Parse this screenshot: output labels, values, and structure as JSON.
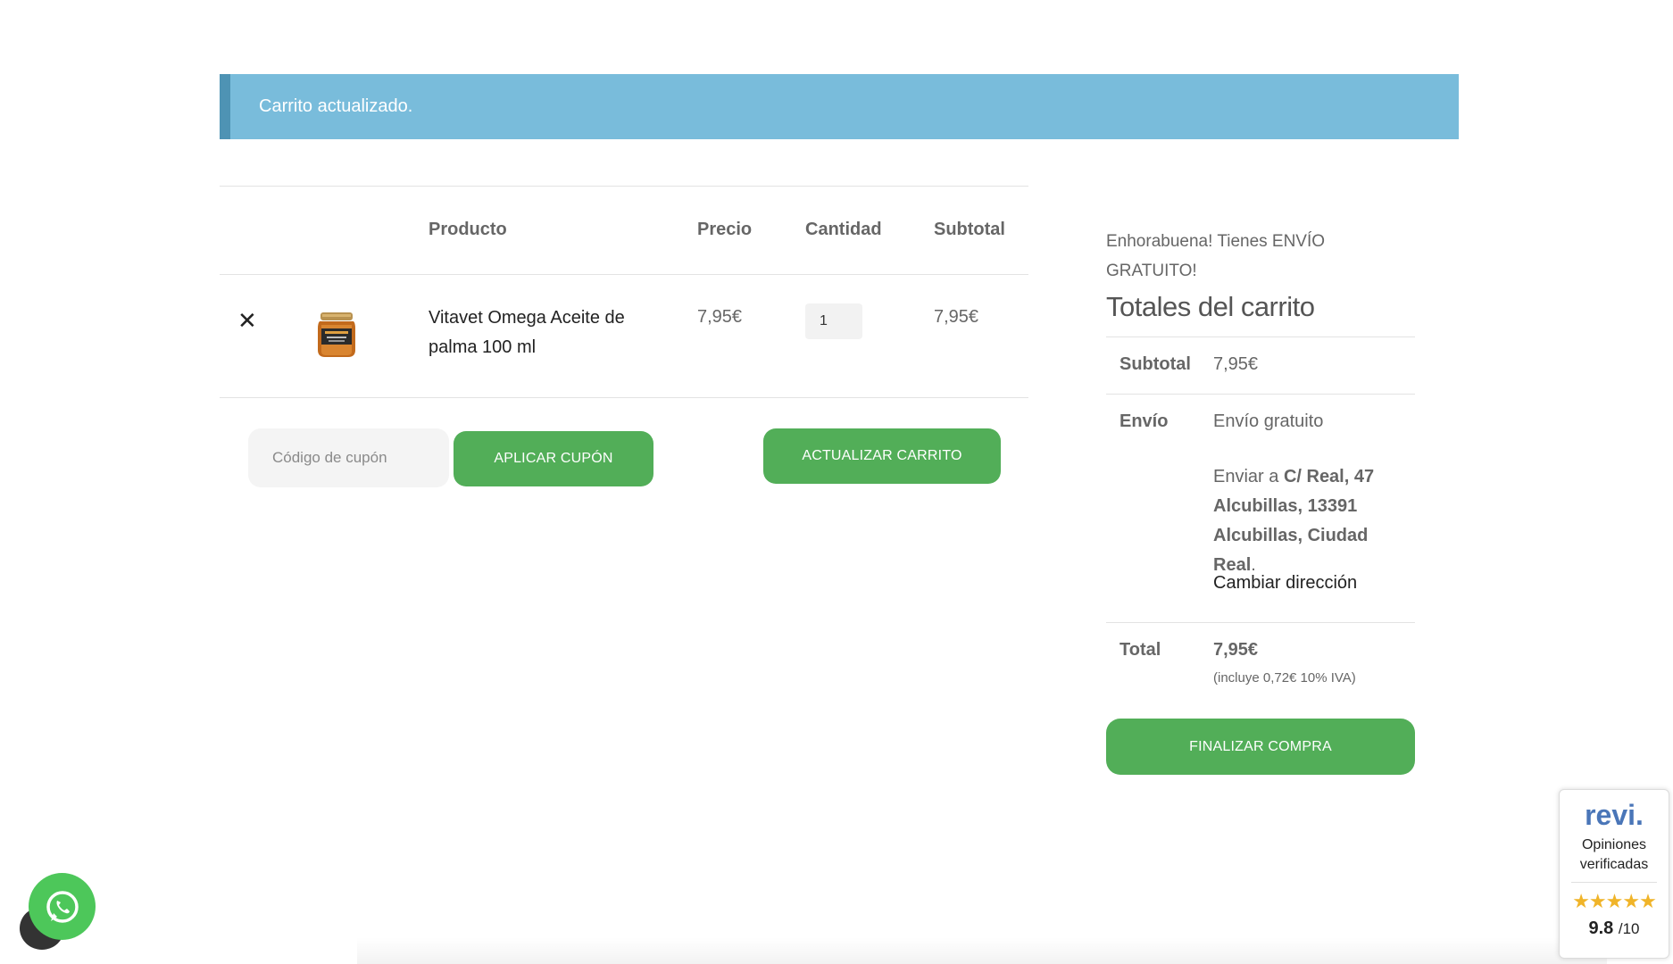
{
  "notice": {
    "text": "Carrito actualizado."
  },
  "cart": {
    "headers": {
      "product": "Producto",
      "price": "Precio",
      "quantity": "Cantidad",
      "subtotal": "Subtotal"
    },
    "items": [
      {
        "name": "Vitavet Omega Aceite de palma 100 ml",
        "price": "7,95€",
        "quantity": "1",
        "subtotal": "7,95€",
        "remove_icon": "close-icon"
      }
    ],
    "coupon_placeholder": "Código de cupón",
    "apply_coupon_label": "APLICAR CUPÓN",
    "update_cart_label": "ACTUALIZAR CARRITO"
  },
  "totals": {
    "free_shipping_msg": "Enhorabuena! Tienes ENVÍO GRATUITO!",
    "title": "Totales del carrito",
    "subtotal_label": "Subtotal",
    "subtotal_value": "7,95€",
    "shipping_label": "Envío",
    "shipping_value": "Envío gratuito",
    "ship_to_prefix": "Enviar a",
    "ship_to_address": "C/ Real, 47 Alcubillas, 13391 Alcubillas, Ciudad Real",
    "ship_to_suffix": ".",
    "change_address": "Cambiar dirección",
    "total_label": "Total",
    "total_value": "7,95€",
    "tax_note": "(incluye 0,72€ 10% IVA)",
    "checkout_label": "FINALIZAR COMPRA"
  },
  "revi_badge": {
    "logo": "revi.",
    "text_line1": "Opiniones",
    "text_line2": "verificadas",
    "stars": "★★★★★",
    "rating": 9.8,
    "score": "9.8",
    "scale": "/10"
  },
  "colors": {
    "notice_bg": "#79bcdb",
    "button_green": "#52ae58",
    "whatsapp_green": "#4dc75a",
    "revi_blue": "#4a76b8",
    "star_gold": "#f0b429"
  }
}
